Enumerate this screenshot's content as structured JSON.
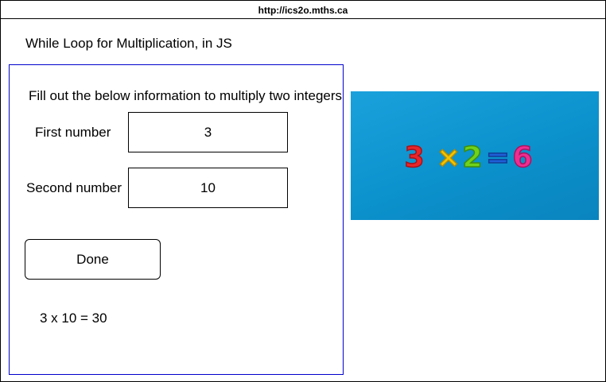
{
  "browser": {
    "url": "http://ics2o.mths.ca"
  },
  "page": {
    "title": "While Loop for Multiplication, in JS"
  },
  "form": {
    "instructions": "Fill out the below information to multiply two integers",
    "first_number": {
      "label": "First number",
      "value": "3"
    },
    "second_number": {
      "label": "Second number",
      "value": "10"
    },
    "done_label": "Done",
    "result": "3 x 10 = 30"
  },
  "image": {
    "description_glyphs": {
      "a": "3",
      "op": "×",
      "b": "2",
      "eq": "=",
      "c": "6"
    },
    "colors": {
      "background": "#0b91cc",
      "three": "#e8262a",
      "times": "#f2c400",
      "two": "#6fd21c",
      "equals": "#1f5fd6",
      "six": "#ee2d91",
      "panel_border": "#0000cc"
    }
  }
}
